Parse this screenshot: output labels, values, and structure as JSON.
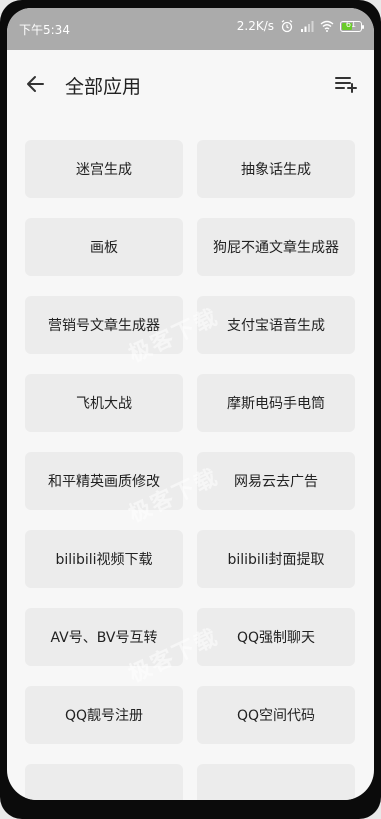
{
  "status_bar": {
    "time": "下午5:34",
    "network_speed": "2.2K/s",
    "battery_level": "61"
  },
  "header": {
    "title": "全部应用"
  },
  "apps": [
    {
      "label": "迷宫生成"
    },
    {
      "label": "抽象话生成"
    },
    {
      "label": "画板"
    },
    {
      "label": "狗屁不通文章生成器"
    },
    {
      "label": "营销号文章生成器"
    },
    {
      "label": "支付宝语音生成"
    },
    {
      "label": "飞机大战"
    },
    {
      "label": "摩斯电码手电筒"
    },
    {
      "label": "和平精英画质修改"
    },
    {
      "label": "网易云去广告"
    },
    {
      "label": "bilibili视频下载"
    },
    {
      "label": "bilibili封面提取"
    },
    {
      "label": "AV号、BV号互转"
    },
    {
      "label": "QQ强制聊天"
    },
    {
      "label": "QQ靓号注册"
    },
    {
      "label": "QQ空间代码"
    },
    {
      "label": ""
    },
    {
      "label": ""
    }
  ],
  "watermark": "极客下载",
  "colors": {
    "status_bar": "#ababab",
    "background": "#f7f7f7",
    "card": "#ececec",
    "battery_fill": "#6acb2a"
  }
}
